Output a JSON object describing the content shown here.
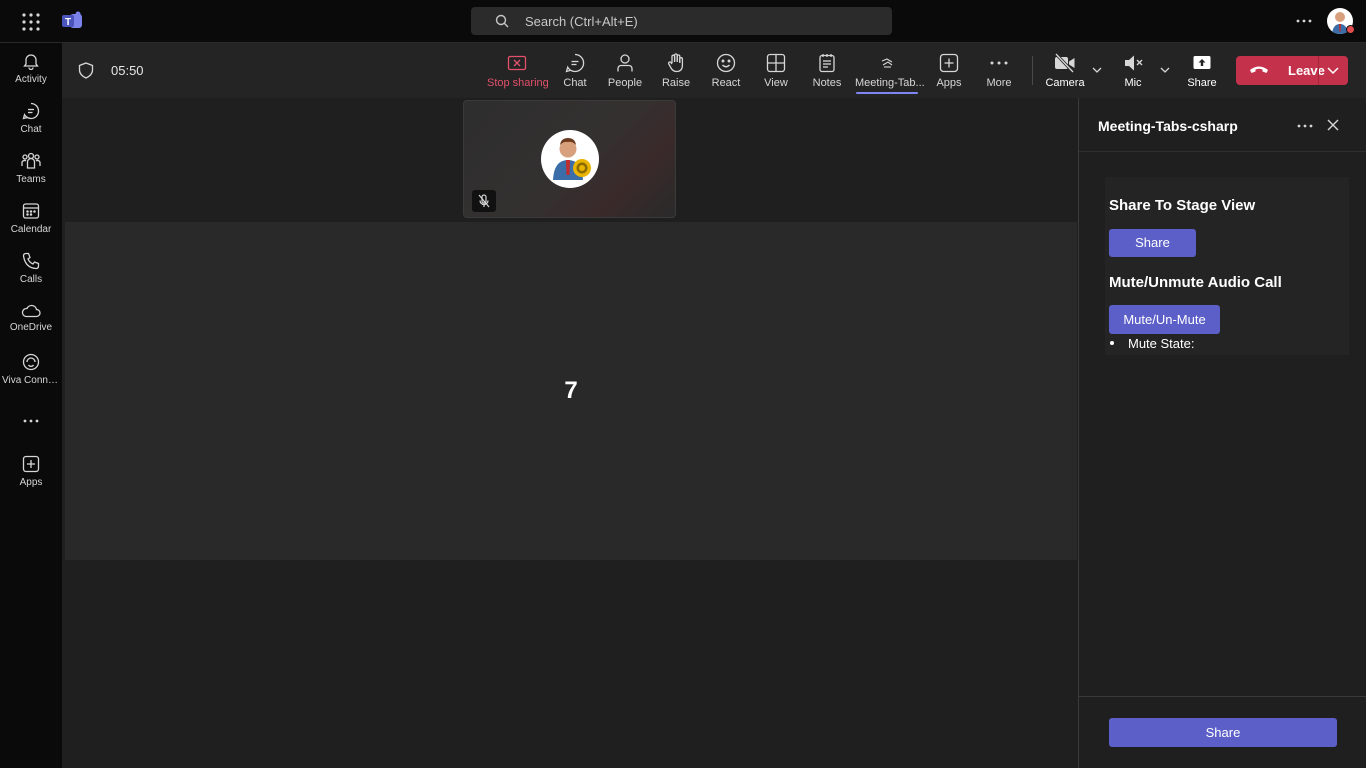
{
  "search": {
    "placeholder": "Search (Ctrl+Alt+E)"
  },
  "rail": {
    "items": [
      {
        "label": "Activity",
        "icon": "bell-icon"
      },
      {
        "label": "Chat",
        "icon": "chat-icon"
      },
      {
        "label": "Teams",
        "icon": "teams-icon"
      },
      {
        "label": "Calendar",
        "icon": "calendar-icon"
      },
      {
        "label": "Calls",
        "icon": "phone-icon"
      },
      {
        "label": "OneDrive",
        "icon": "cloud-icon"
      },
      {
        "label": "Viva Conne...",
        "icon": "viva-icon"
      },
      {
        "label": "Apps",
        "icon": "add-app-icon"
      }
    ]
  },
  "meeting": {
    "timer": "05:50",
    "toolbar": {
      "stop_sharing": "Stop sharing",
      "chat": "Chat",
      "people": "People",
      "raise": "Raise",
      "react": "React",
      "view": "View",
      "notes": "Notes",
      "meeting_tab": "Meeting-Tab...",
      "apps": "Apps",
      "more": "More",
      "camera": "Camera",
      "mic": "Mic",
      "share": "Share",
      "leave": "Leave"
    },
    "stage_counter": "7"
  },
  "panel": {
    "title": "Meeting-Tabs-csharp",
    "share_heading": "Share To Stage View",
    "share_button": "Share",
    "mute_heading": "Mute/Unmute Audio Call",
    "mute_button": "Mute/Un-Mute",
    "mute_state_label": "Mute State:",
    "footer_share_button": "Share"
  },
  "colors": {
    "accent": "#5b5fc7",
    "leave": "#c4314b",
    "stop_sharing": "#e3506b"
  }
}
